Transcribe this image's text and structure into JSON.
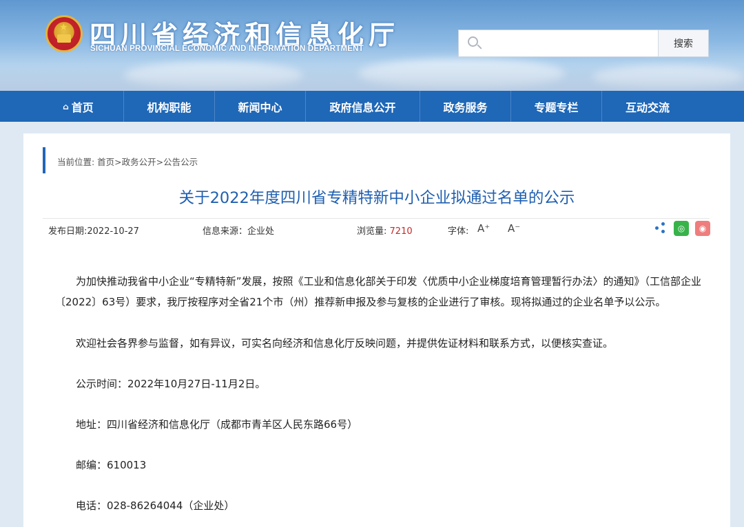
{
  "header": {
    "title": "四川省经济和信息化厅",
    "subtitle": "SICHUAN PROVINCIAL ECONOMIC AND INFORMATION DEPARTMENT",
    "search": {
      "placeholder": "",
      "button_label": "搜索"
    }
  },
  "nav": {
    "items": [
      {
        "label": "首页",
        "icon": "home-icon"
      },
      {
        "label": "机构职能"
      },
      {
        "label": "新闻中心"
      },
      {
        "label": "政府信息公开"
      },
      {
        "label": "政务服务"
      },
      {
        "label": "专题专栏"
      },
      {
        "label": "互动交流"
      }
    ]
  },
  "breadcrumb": "当前位置: 首页>政务公开>公告公示",
  "article": {
    "title": "关于2022年度四川省专精特新中小企业拟通过名单的公示",
    "publish_date": "发布日期:2022-10-27",
    "source": "信息来源：企业处",
    "views_label": "浏览量:",
    "views": "7210",
    "font_label": "字体:",
    "font_up": "A⁺",
    "font_down": "A⁻",
    "paragraphs": [
      "为加快推动我省中小企业“专精特新”发展，按照《工业和信息化部关于印发〈优质中小企业梯度培育管理暂行办法〉的通知》（工信部企业〔2022〕63号）要求，我厅按程序对全省21个市（州）推荐新申报及参与复核的企业进行了审核。现将拟通过的企业名单予以公示。",
      "欢迎社会各界参与监督，如有异议，可实名向经济和信息化厅反映问题，并提供佐证材料和联系方式，以便核实查证。",
      "公示时间：2022年10月27日-11月2日。",
      "地址：四川省经济和信息化厅（成都市青羊区人民东路66号）",
      "邮编：610013",
      "电话：028-86264044（企业处）"
    ]
  },
  "colors": {
    "nav_bg": "#1f67b7",
    "title": "#1f5fb0",
    "views": "#c62828"
  }
}
